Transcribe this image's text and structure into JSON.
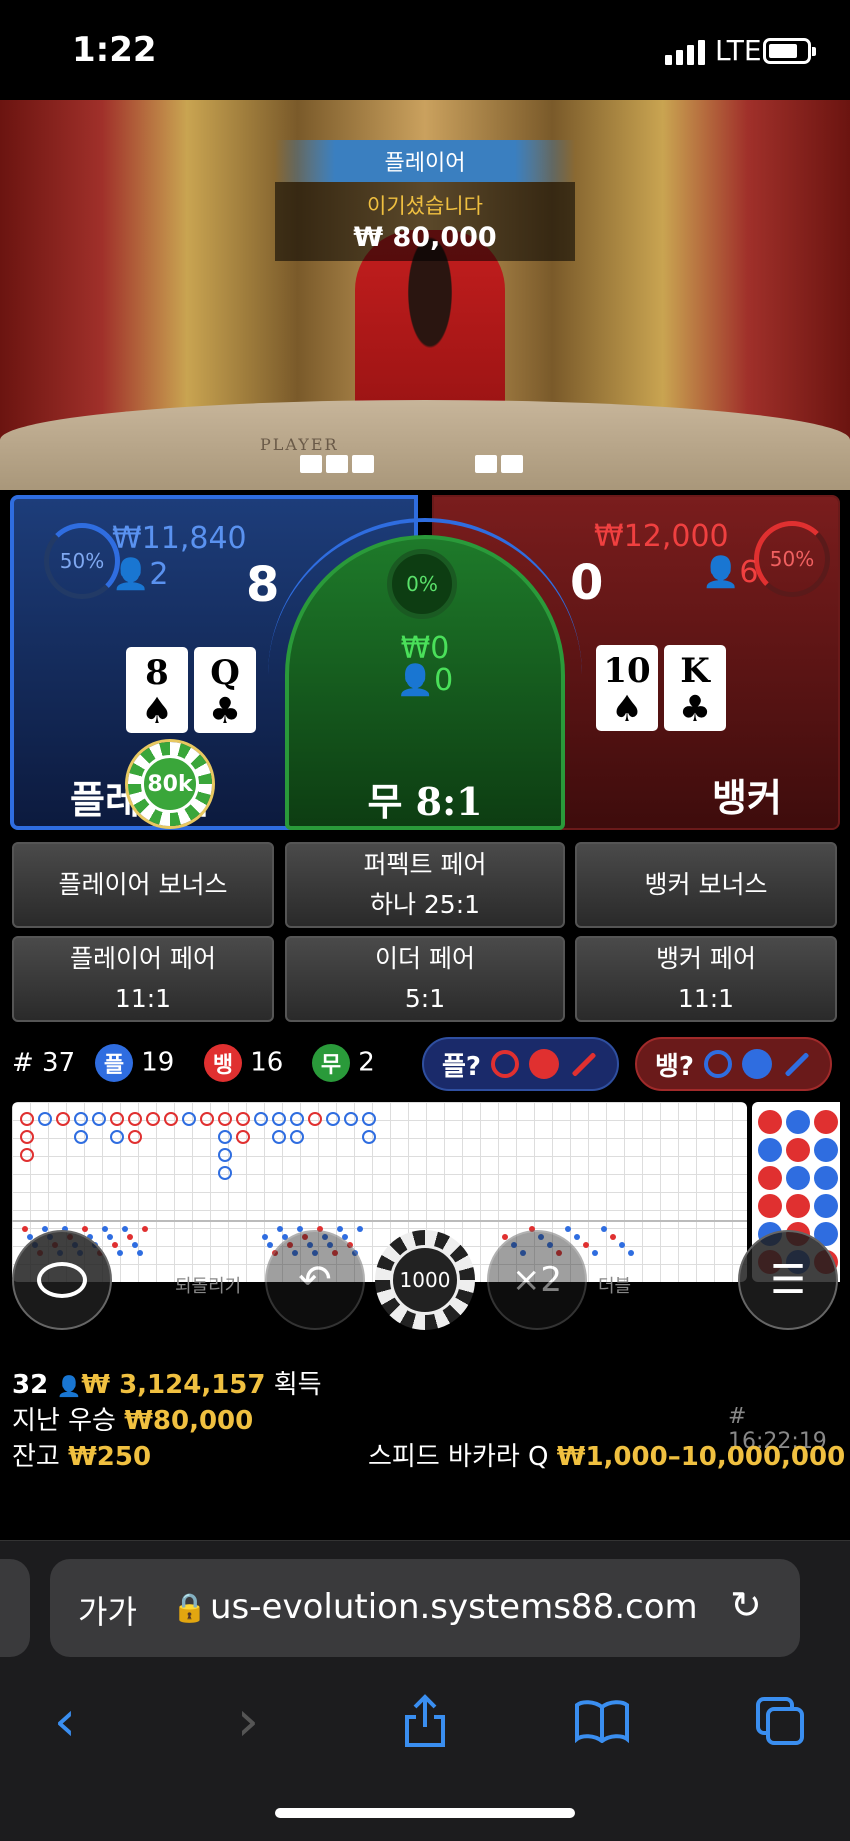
{
  "status_bar": {
    "time": "1:22",
    "network": "LTE"
  },
  "video": {
    "win_banner": {
      "title": "플레이어",
      "message": "이기셨습니다",
      "amount": "₩ 80,000"
    },
    "felt_label": "PLAYER"
  },
  "player_zone": {
    "percent": "50%",
    "amount": "₩11,840",
    "bettors": "2",
    "score": "8",
    "cards": [
      {
        "rank": "8",
        "suit": "♠"
      },
      {
        "rank": "Q",
        "suit": "♣"
      }
    ],
    "label": "플레이어",
    "chip": "80k",
    "color": "#2f6de0"
  },
  "tie_zone": {
    "percent": "0%",
    "amount": "₩0",
    "bettors": "0",
    "label": "무 8:1",
    "color": "#2a9a3a"
  },
  "banker_zone": {
    "percent": "50%",
    "amount": "₩12,000",
    "bettors": "6",
    "score": "0",
    "cards": [
      {
        "rank": "10",
        "suit": "♠"
      },
      {
        "rank": "K",
        "suit": "♣"
      }
    ],
    "label": "뱅커",
    "color": "#e03030"
  },
  "side_bets": [
    {
      "label": "플레이어 보너스",
      "odds": ""
    },
    {
      "label": "퍼펙트 페어",
      "odds": "하나 25:1"
    },
    {
      "label": "뱅커 보너스",
      "odds": ""
    },
    {
      "label": "플레이어 페어",
      "odds": "11:1"
    },
    {
      "label": "이더 페어",
      "odds": "5:1"
    },
    {
      "label": "뱅커 페어",
      "odds": "11:1"
    }
  ],
  "stats": {
    "round": "# 37",
    "player_label": "플",
    "player_count": "19",
    "banker_label": "뱅",
    "banker_count": "16",
    "tie_label": "무",
    "tie_count": "2",
    "predict_player": "플?",
    "predict_banker": "뱅?"
  },
  "controls": {
    "chip_value": "1000",
    "undo_caption": "되돌리기",
    "double_label": "×2",
    "double_caption": "더블"
  },
  "info": {
    "players": "32",
    "total_won": "₩ 3,124,157",
    "won_label": "획득",
    "last_win_label": "지난 우승",
    "last_win": "₩80,000",
    "round_id": "# 16:22:19",
    "balance_label": "잔고",
    "balance": "₩250",
    "table_name": "스피드 바카라 Q",
    "limits": "₩1,000–10,000,000"
  },
  "browser": {
    "text_size": "가가",
    "url": "us-evolution.systems88.com"
  }
}
